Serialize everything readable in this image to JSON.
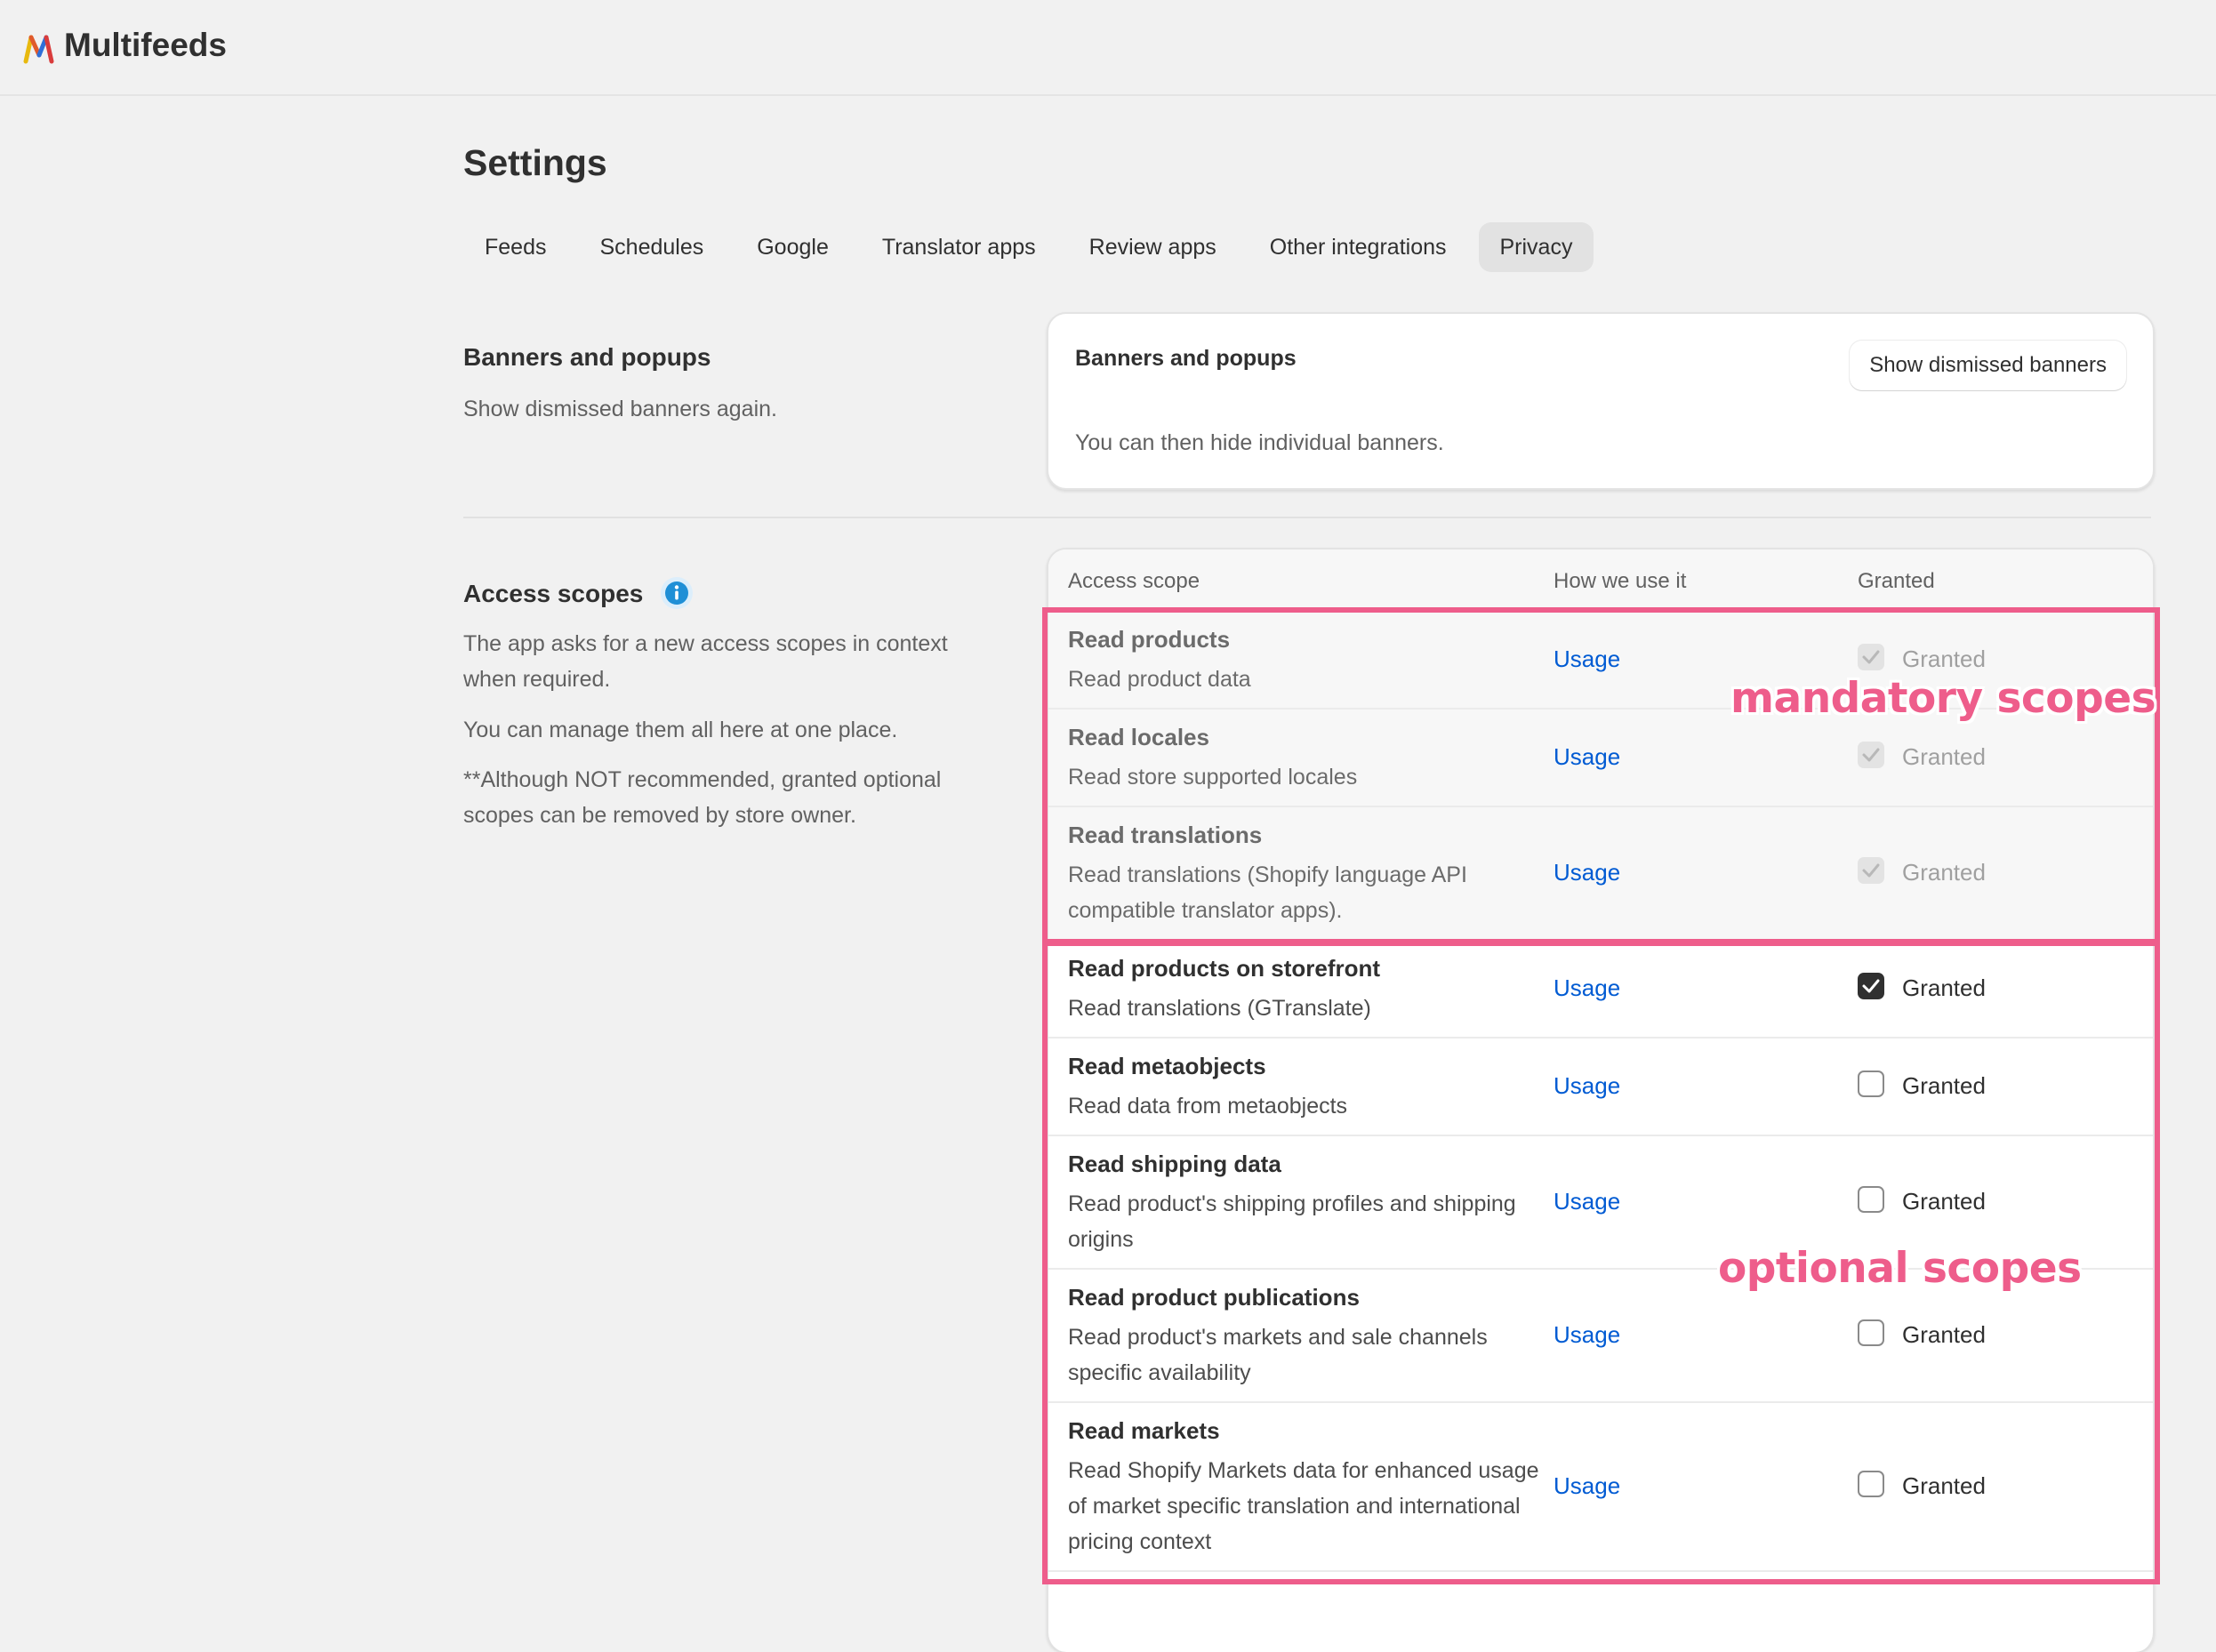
{
  "app": {
    "name": "Multifeeds",
    "logo_letter": "M"
  },
  "page": {
    "title": "Settings"
  },
  "tabs": [
    {
      "label": "Feeds",
      "active": false
    },
    {
      "label": "Schedules",
      "active": false
    },
    {
      "label": "Google",
      "active": false
    },
    {
      "label": "Translator apps",
      "active": false
    },
    {
      "label": "Review apps",
      "active": false
    },
    {
      "label": "Other integrations",
      "active": false
    },
    {
      "label": "Privacy",
      "active": true
    }
  ],
  "banners": {
    "section_title": "Banners and popups",
    "section_text": "Show dismissed banners again.",
    "card_title": "Banners and popups",
    "card_text": "You can then hide individual banners.",
    "button_label": "Show dismissed banners"
  },
  "access": {
    "section_title": "Access scopes",
    "para1": "The app asks for a new access scopes in context when required.",
    "para2": "You can manage them all here at one place.",
    "para3": "**Although NOT recommended, granted optional scopes can be removed by store owner.",
    "columns": {
      "scope": "Access scope",
      "use": "How we use it",
      "granted": "Granted"
    },
    "rows": [
      {
        "title": "Read products",
        "desc": "Read product data",
        "usage": "Usage",
        "granted_label": "Granted",
        "checked": true,
        "mandatory": true
      },
      {
        "title": "Read locales",
        "desc": "Read store supported locales",
        "usage": "Usage",
        "granted_label": "Granted",
        "checked": true,
        "mandatory": true
      },
      {
        "title": "Read translations",
        "desc": "Read translations (Shopify language API compatible translator apps).",
        "usage": "Usage",
        "granted_label": "Granted",
        "checked": true,
        "mandatory": true
      },
      {
        "title": "Read products on storefront",
        "desc": "Read translations (GTranslate)",
        "usage": "Usage",
        "granted_label": "Granted",
        "checked": true,
        "mandatory": false
      },
      {
        "title": "Read metaobjects",
        "desc": "Read data from metaobjects",
        "usage": "Usage",
        "granted_label": "Granted",
        "checked": false,
        "mandatory": false
      },
      {
        "title": "Read shipping data",
        "desc": "Read product's shipping profiles and shipping origins",
        "usage": "Usage",
        "granted_label": "Granted",
        "checked": false,
        "mandatory": false
      },
      {
        "title": "Read product publications",
        "desc": "Read product's markets and sale channels specific availability",
        "usage": "Usage",
        "granted_label": "Granted",
        "checked": false,
        "mandatory": false
      },
      {
        "title": "Read markets",
        "desc": "Read Shopify Markets data for enhanced usage of market specific translation and international pricing context",
        "usage": "Usage",
        "granted_label": "Granted",
        "checked": false,
        "mandatory": false
      }
    ]
  },
  "annotations": {
    "mandatory": "mandatory scopes",
    "optional": "optional scopes"
  },
  "colors": {
    "accent_link": "#005bd3",
    "annotation": "#ee5d8b",
    "info_icon": "#1f8fd6"
  },
  "icons": {
    "info": "info-icon",
    "check": "check-icon",
    "logo": "multifeeds-logo-icon"
  }
}
